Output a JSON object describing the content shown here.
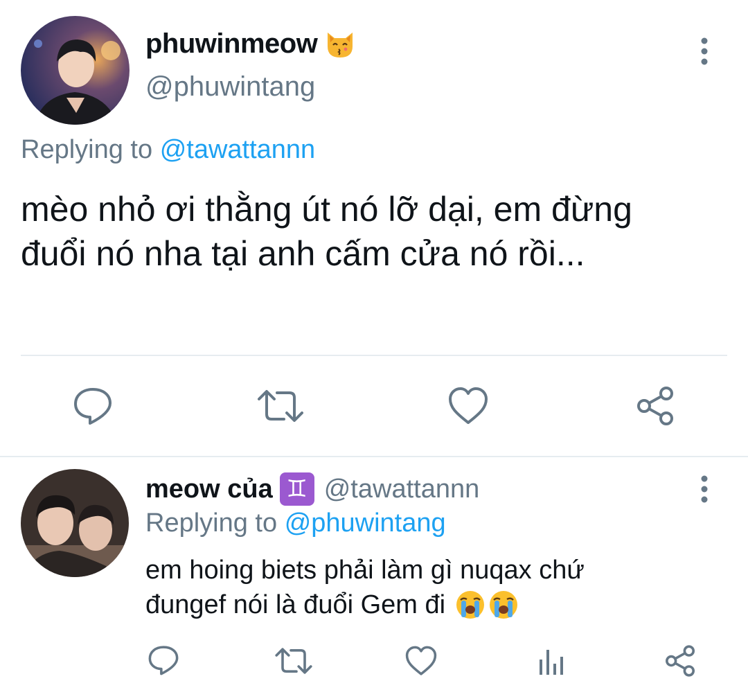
{
  "main_tweet": {
    "display_name": "phuwinmeow",
    "name_emoji": "kissing-cat-emoji",
    "handle": "@phuwintang",
    "replying_label": "Replying to",
    "replying_handle": "@tawattannn",
    "text_line1": "mèo nhỏ ơi thằng út nó lỡ dại, em đừng",
    "text_line2": "đuổi nó nha tại anh cấm cửa nó rồi...",
    "actions": [
      "reply-icon",
      "retweet-icon",
      "like-icon",
      "share-icon"
    ]
  },
  "reply_tweet": {
    "display_name": "meow của",
    "name_badge": "♊",
    "handle": "@tawattannn",
    "replying_label": "Replying to",
    "replying_handle": "@phuwintang",
    "text_line1": "em hoing biets phải làm gì nuqax chứ",
    "text_line2": "đungef nói là đuổi Gem đi",
    "text_emojis": [
      "loudly-crying-face-emoji",
      "loudly-crying-face-emoji"
    ],
    "actions": [
      "reply-icon",
      "retweet-icon",
      "like-icon",
      "analytics-icon",
      "share-icon"
    ]
  },
  "colors": {
    "text": "#0f1419",
    "muted": "#657786",
    "link": "#1da1f2",
    "divider": "#e6ecf0",
    "gemini_badge": "#9b59d0"
  }
}
